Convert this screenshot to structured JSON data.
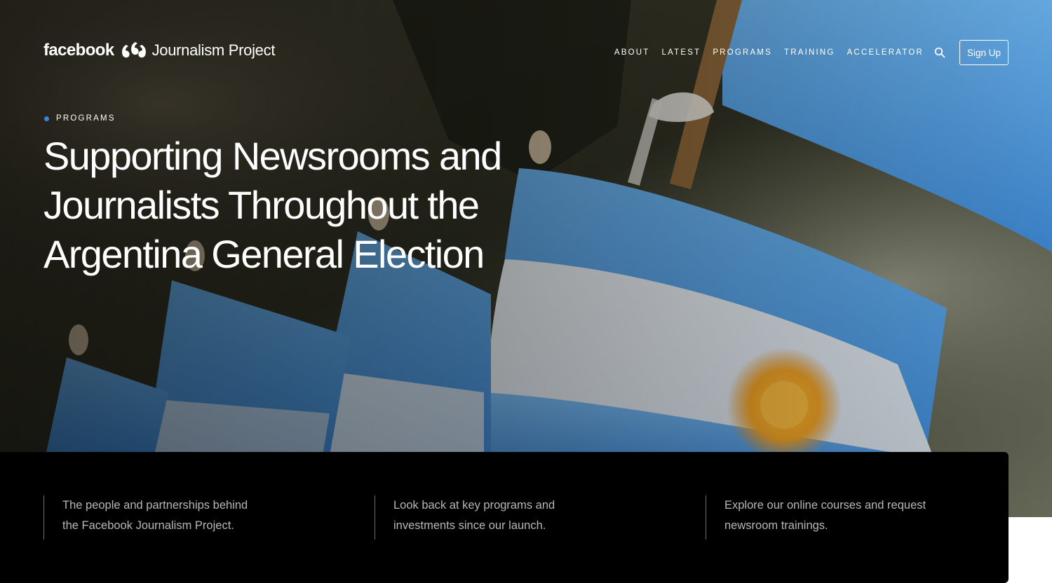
{
  "header": {
    "logo_brand": "facebook",
    "logo_product": "Journalism Project",
    "nav": [
      "ABOUT",
      "LATEST",
      "PROGRAMS",
      "TRAINING",
      "ACCELERATOR"
    ],
    "search_icon": "search-icon",
    "signup_label": "Sign Up"
  },
  "hero": {
    "eyebrow": "PROGRAMS",
    "headline": "Supporting Newsrooms and Journalists Throughout the Argentina General Election"
  },
  "panel": {
    "items": [
      {
        "text": "The people and partnerships behind the Facebook Journalism Project."
      },
      {
        "text": "Look back at key programs and investments since our launch."
      },
      {
        "text": "Explore our online courses and request newsroom trainings."
      }
    ]
  },
  "colors": {
    "accent_dot": "#3b82e6",
    "panel_bg": "#000000",
    "flag_blue": "#5aa3e0",
    "sun": "#e8a321"
  }
}
